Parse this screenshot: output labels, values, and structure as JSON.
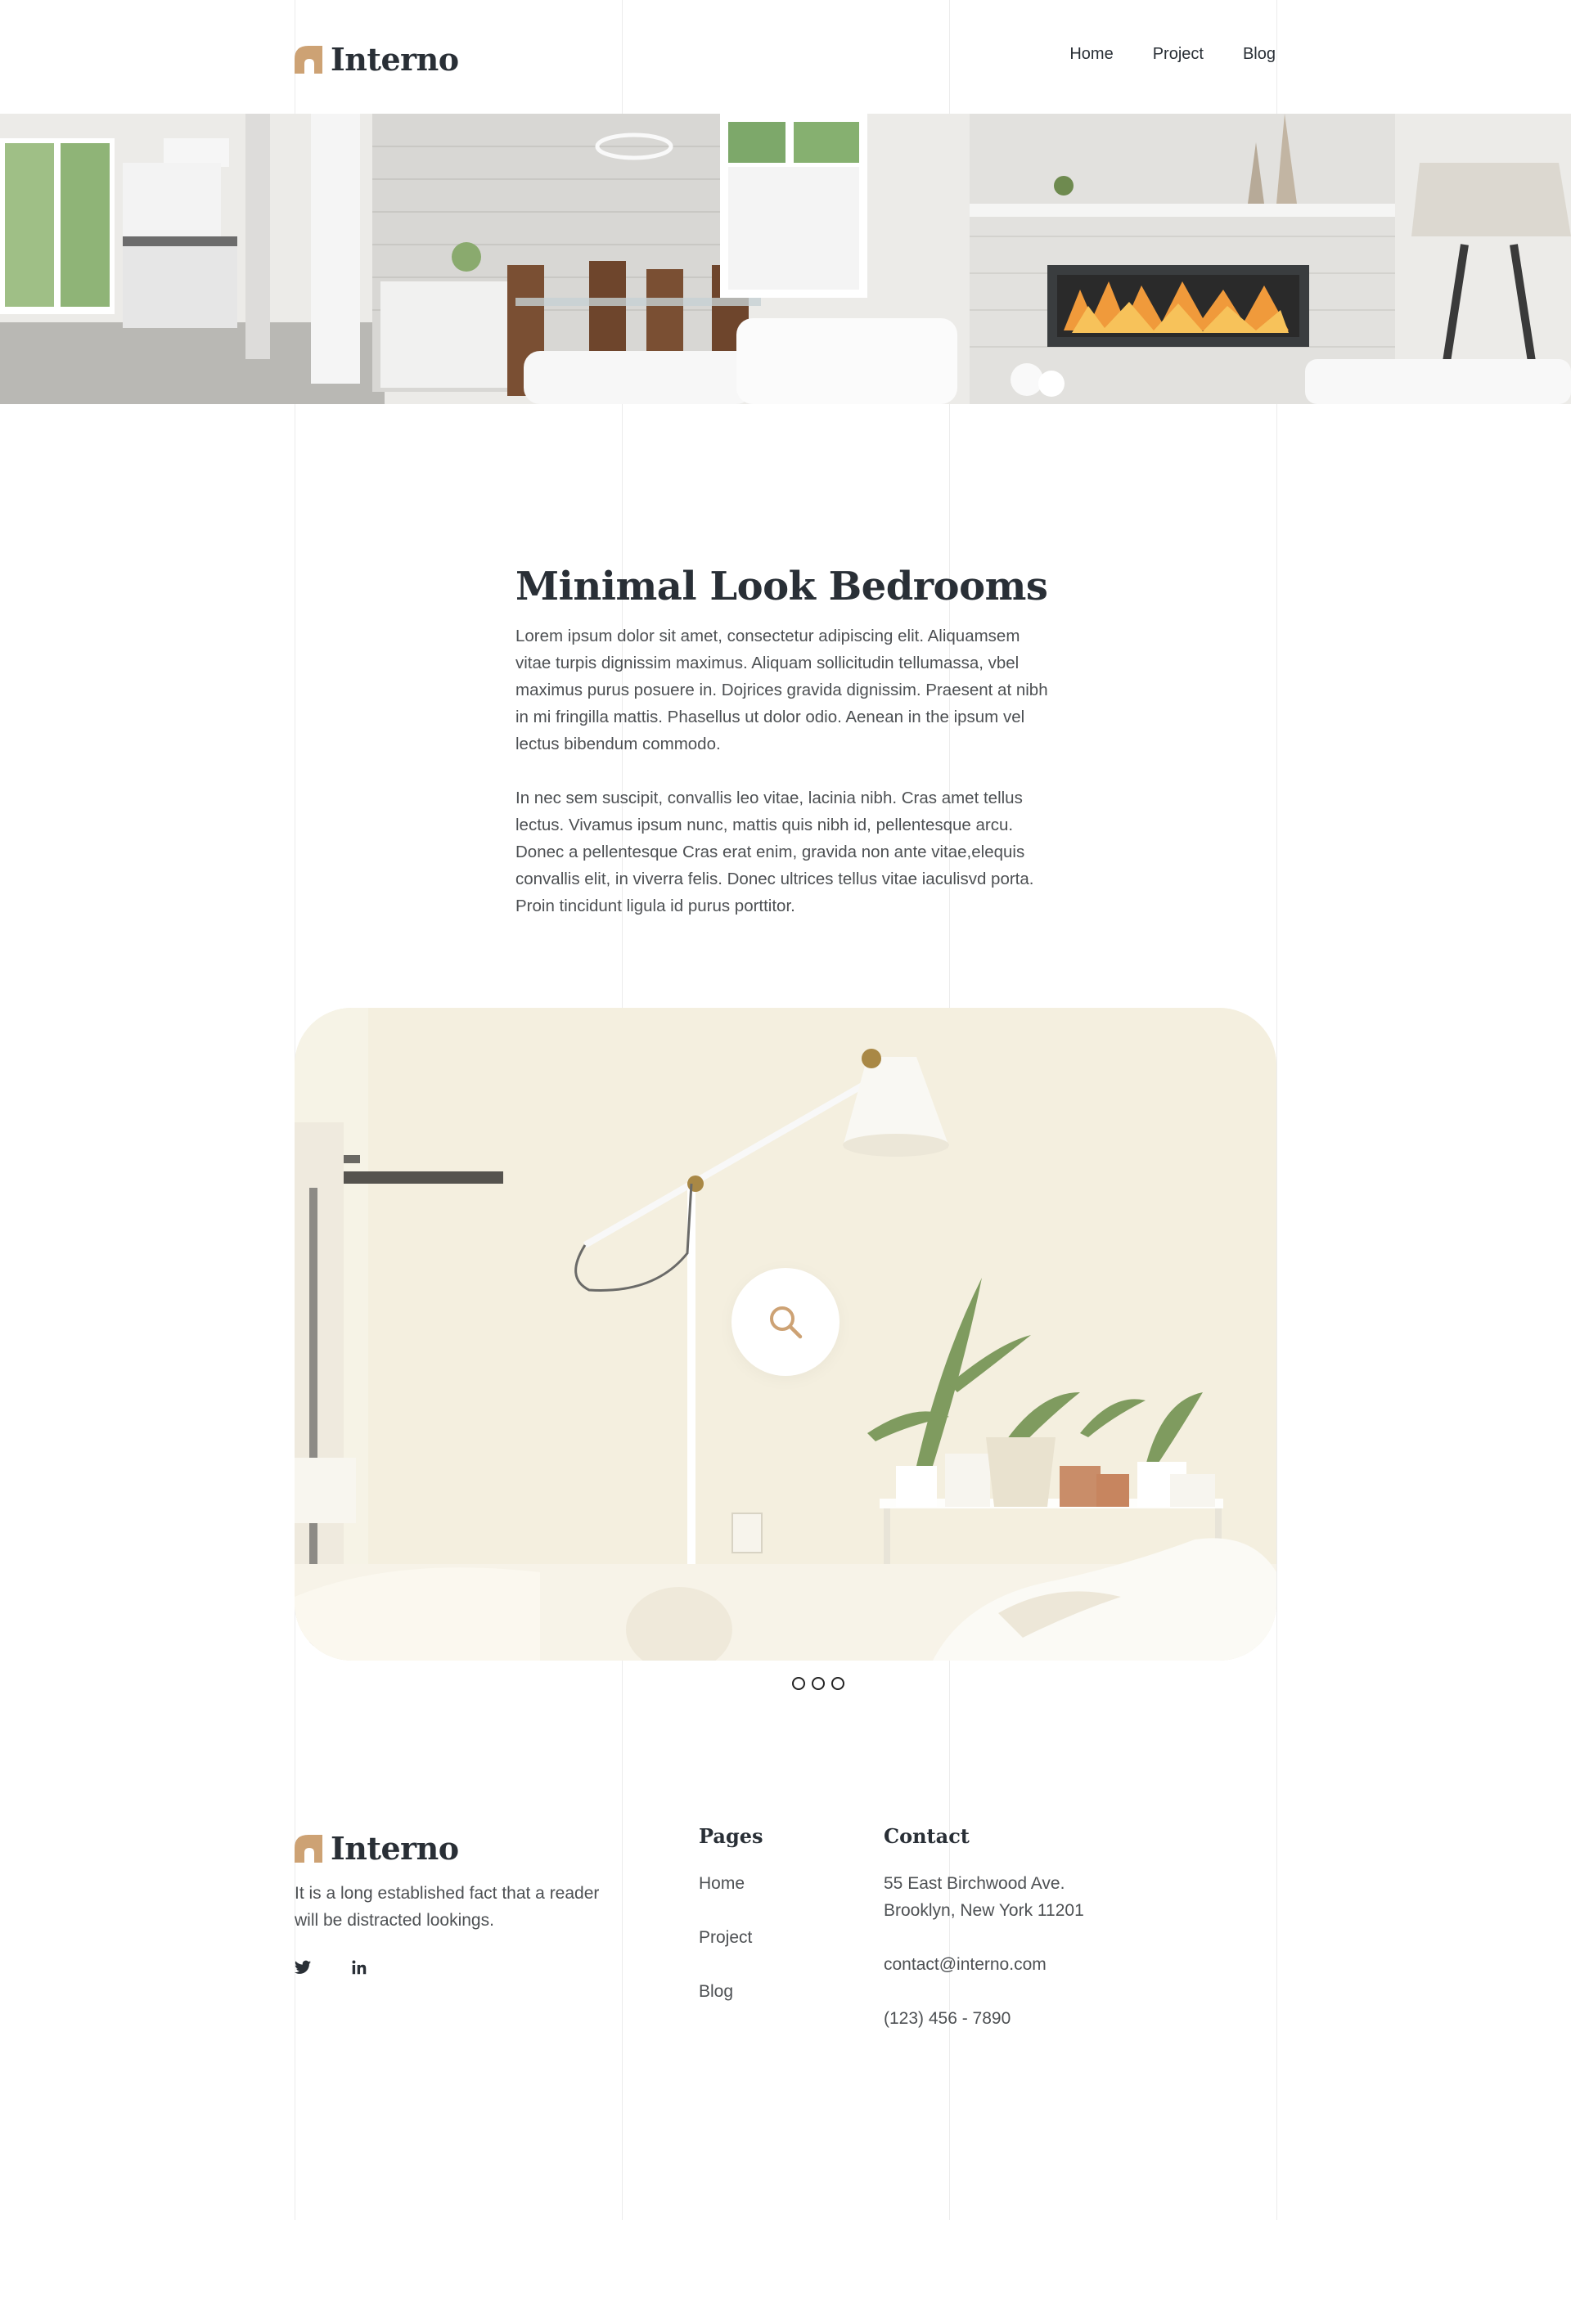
{
  "brand": {
    "name": "Interno",
    "accent": "#CDA274"
  },
  "nav": {
    "items": [
      "Home",
      "Project",
      "Blog"
    ]
  },
  "article": {
    "title": "Minimal Look Bedrooms",
    "paragraphs": [
      "Lorem ipsum dolor sit amet, consectetur adipiscing elit. Aliquamsem vitae turpis dignissim maximus. Aliquam sollicitudin tellumassa, vbel maximus purus posuere in. Dojrices gravida dignissim. Praesent at nibh in mi fringilla mattis. Phasellus ut dolor odio. Aenean in the ipsum vel lectus bibendum commodo.",
      "In nec sem suscipit, convallis leo vitae, lacinia nibh. Cras amet tellus lectus. Vivamus ipsum nunc, mattis quis nibh id, pellentesque arcu. Donec a pellentesque Cras erat enim, gravida non ante vitae,elequis convallis elit, in viverra felis. Donec ultrices tellus vitae iaculisvd porta. Proin tincidunt ligula id purus porttitor."
    ]
  },
  "footer": {
    "brand": "Interno",
    "description": "It is a long established fact that a reader will be distracted lookings.",
    "social": [
      "twitter-icon",
      "linkedin-icon"
    ],
    "pages": {
      "title": "Pages",
      "items": [
        "Home",
        "Project",
        "Blog"
      ]
    },
    "contact": {
      "title": "Contact",
      "address_line1": "55 East Birchwood Ave.",
      "address_line2": "Brooklyn, New York 11201",
      "email": "contact@interno.com",
      "phone": "(123) 456 - 7890"
    }
  },
  "colors": {
    "heading": "#292F36",
    "body": "#4D5053",
    "accent": "#CDA274"
  }
}
